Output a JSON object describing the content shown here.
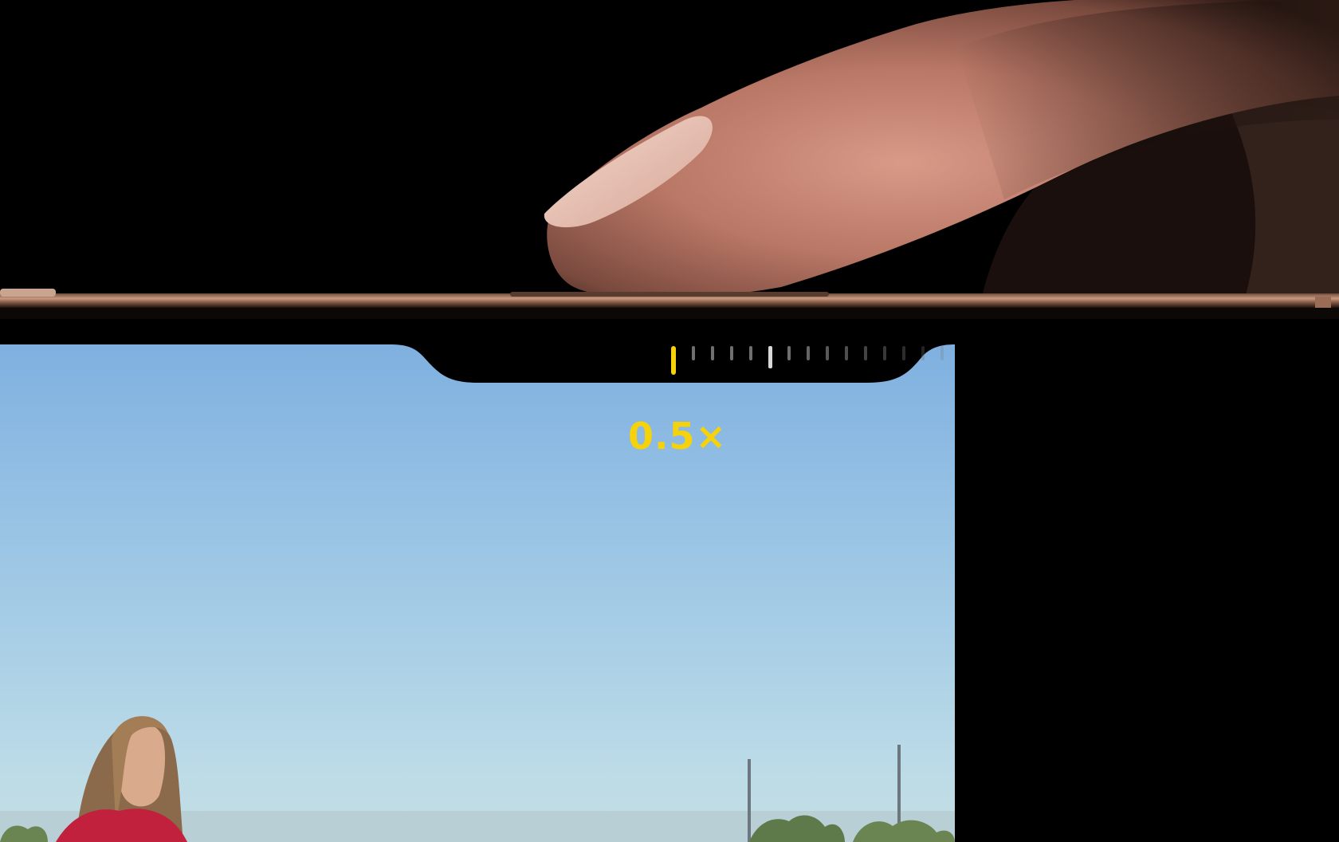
{
  "zoom": {
    "value_label": "0.5×",
    "level_fraction": 0.0,
    "accent_color": "#f5d20a"
  },
  "icons": {
    "finger": "finger-touch-icon",
    "person": "person-photo-subject"
  }
}
